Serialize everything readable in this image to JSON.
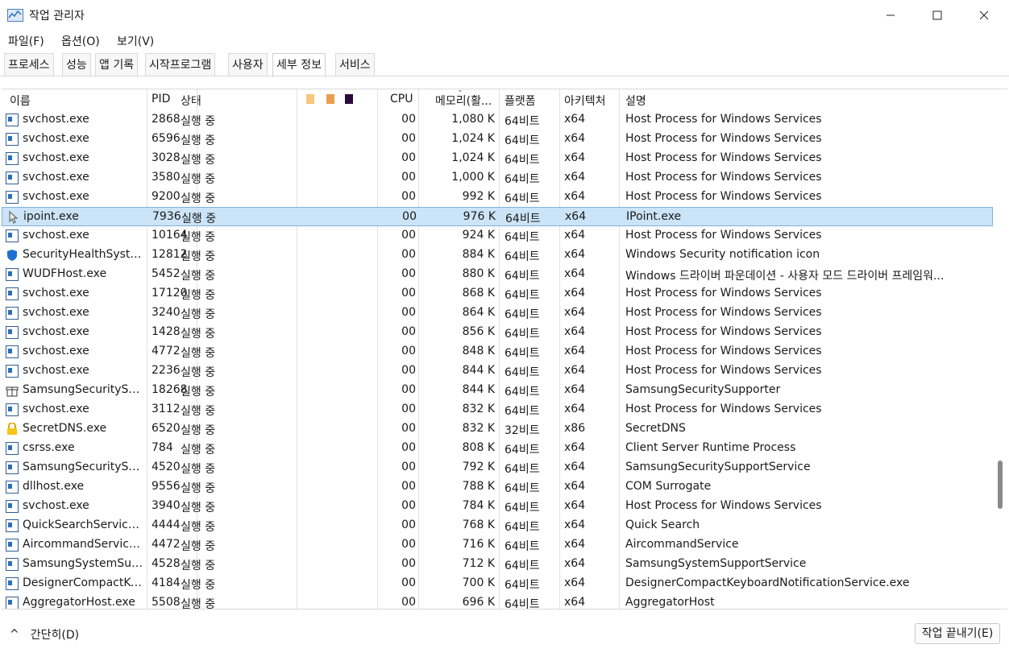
{
  "window": {
    "title": "작업 관리자"
  },
  "menu": [
    {
      "label": "파일(F)"
    },
    {
      "label": "옵션(O)"
    },
    {
      "label": "보기(V)"
    }
  ],
  "tabs": [
    {
      "label": "프로세스"
    },
    {
      "label": "성능"
    },
    {
      "label": "앱 기록"
    },
    {
      "label": "시작프로그램"
    },
    {
      "label": "사용자"
    },
    {
      "label": "세부 정보",
      "active": true
    },
    {
      "label": "서비스"
    }
  ],
  "columns": {
    "name": "이름",
    "pid": "PID",
    "status": "상태",
    "cpu": "CPU",
    "memory": "메모리(활...",
    "platform": "플랫폼",
    "arch": "아키텍처",
    "desc": "설명"
  },
  "rows": [
    {
      "icon": "window-icon",
      "name": "svchost.exe",
      "pid": "2868",
      "status": "실행 중",
      "cpu": "00",
      "mem": "1,080 K",
      "plat": "64비트",
      "arch": "x64",
      "desc": "Host Process for Windows Services"
    },
    {
      "icon": "window-icon",
      "name": "svchost.exe",
      "pid": "6596",
      "status": "실행 중",
      "cpu": "00",
      "mem": "1,024 K",
      "plat": "64비트",
      "arch": "x64",
      "desc": "Host Process for Windows Services"
    },
    {
      "icon": "window-icon",
      "name": "svchost.exe",
      "pid": "3028",
      "status": "실행 중",
      "cpu": "00",
      "mem": "1,024 K",
      "plat": "64비트",
      "arch": "x64",
      "desc": "Host Process for Windows Services"
    },
    {
      "icon": "window-icon",
      "name": "svchost.exe",
      "pid": "3580",
      "status": "실행 중",
      "cpu": "00",
      "mem": "1,000 K",
      "plat": "64비트",
      "arch": "x64",
      "desc": "Host Process for Windows Services"
    },
    {
      "icon": "window-icon",
      "name": "svchost.exe",
      "pid": "9200",
      "status": "실행 중",
      "cpu": "00",
      "mem": "992 K",
      "plat": "64비트",
      "arch": "x64",
      "desc": "Host Process for Windows Services"
    },
    {
      "icon": "cursor-icon",
      "name": "ipoint.exe",
      "pid": "7936",
      "status": "실행 중",
      "cpu": "00",
      "mem": "976 K",
      "plat": "64비트",
      "arch": "x64",
      "desc": "IPoint.exe",
      "selected": true
    },
    {
      "icon": "window-icon",
      "name": "svchost.exe",
      "pid": "10164",
      "status": "실행 중",
      "cpu": "00",
      "mem": "924 K",
      "plat": "64비트",
      "arch": "x64",
      "desc": "Host Process for Windows Services"
    },
    {
      "icon": "shield-icon",
      "name": "SecurityHealthSystra...",
      "pid": "12812",
      "status": "실행 중",
      "cpu": "00",
      "mem": "884 K",
      "plat": "64비트",
      "arch": "x64",
      "desc": "Windows Security notification icon"
    },
    {
      "icon": "window-icon",
      "name": "WUDFHost.exe",
      "pid": "5452",
      "status": "실행 중",
      "cpu": "00",
      "mem": "880 K",
      "plat": "64비트",
      "arch": "x64",
      "desc": "Windows 드라이버 파운데이션 - 사용자 모드 드라이버 프레임워..."
    },
    {
      "icon": "window-icon",
      "name": "svchost.exe",
      "pid": "17120",
      "status": "실행 중",
      "cpu": "00",
      "mem": "868 K",
      "plat": "64비트",
      "arch": "x64",
      "desc": "Host Process for Windows Services"
    },
    {
      "icon": "window-icon",
      "name": "svchost.exe",
      "pid": "3240",
      "status": "실행 중",
      "cpu": "00",
      "mem": "864 K",
      "plat": "64비트",
      "arch": "x64",
      "desc": "Host Process for Windows Services"
    },
    {
      "icon": "window-icon",
      "name": "svchost.exe",
      "pid": "1428",
      "status": "실행 중",
      "cpu": "00",
      "mem": "856 K",
      "plat": "64비트",
      "arch": "x64",
      "desc": "Host Process for Windows Services"
    },
    {
      "icon": "window-icon",
      "name": "svchost.exe",
      "pid": "4772",
      "status": "실행 중",
      "cpu": "00",
      "mem": "848 K",
      "plat": "64비트",
      "arch": "x64",
      "desc": "Host Process for Windows Services"
    },
    {
      "icon": "window-icon",
      "name": "svchost.exe",
      "pid": "2236",
      "status": "실행 중",
      "cpu": "00",
      "mem": "844 K",
      "plat": "64비트",
      "arch": "x64",
      "desc": "Host Process for Windows Services"
    },
    {
      "icon": "gift-icon",
      "name": "SamsungSecuritySup...",
      "pid": "18268",
      "status": "실행 중",
      "cpu": "00",
      "mem": "844 K",
      "plat": "64비트",
      "arch": "x64",
      "desc": "SamsungSecuritySupporter"
    },
    {
      "icon": "window-icon",
      "name": "svchost.exe",
      "pid": "3112",
      "status": "실행 중",
      "cpu": "00",
      "mem": "832 K",
      "plat": "64비트",
      "arch": "x64",
      "desc": "Host Process for Windows Services"
    },
    {
      "icon": "lock-icon",
      "name": "SecretDNS.exe",
      "pid": "6520",
      "status": "실행 중",
      "cpu": "00",
      "mem": "832 K",
      "plat": "32비트",
      "arch": "x86",
      "desc": "SecretDNS"
    },
    {
      "icon": "window-icon",
      "name": "csrss.exe",
      "pid": "784",
      "status": "실행 중",
      "cpu": "00",
      "mem": "808 K",
      "plat": "64비트",
      "arch": "x64",
      "desc": "Client Server Runtime Process"
    },
    {
      "icon": "window-icon",
      "name": "SamsungSecuritySup...",
      "pid": "4520",
      "status": "실행 중",
      "cpu": "00",
      "mem": "792 K",
      "plat": "64비트",
      "arch": "x64",
      "desc": "SamsungSecuritySupportService"
    },
    {
      "icon": "window-icon",
      "name": "dllhost.exe",
      "pid": "9556",
      "status": "실행 중",
      "cpu": "00",
      "mem": "788 K",
      "plat": "64비트",
      "arch": "x64",
      "desc": "COM Surrogate"
    },
    {
      "icon": "window-icon",
      "name": "svchost.exe",
      "pid": "3940",
      "status": "실행 중",
      "cpu": "00",
      "mem": "784 K",
      "plat": "64비트",
      "arch": "x64",
      "desc": "Host Process for Windows Services"
    },
    {
      "icon": "window-icon",
      "name": "QuickSearchService....",
      "pid": "4444",
      "status": "실행 중",
      "cpu": "00",
      "mem": "768 K",
      "plat": "64비트",
      "arch": "x64",
      "desc": "Quick Search"
    },
    {
      "icon": "window-icon",
      "name": "AircommandService....",
      "pid": "4472",
      "status": "실행 중",
      "cpu": "00",
      "mem": "716 K",
      "plat": "64비트",
      "arch": "x64",
      "desc": "AircommandService"
    },
    {
      "icon": "window-icon",
      "name": "SamsungSystemSup...",
      "pid": "4528",
      "status": "실행 중",
      "cpu": "00",
      "mem": "712 K",
      "plat": "64비트",
      "arch": "x64",
      "desc": "SamsungSystemSupportService"
    },
    {
      "icon": "window-icon",
      "name": "DesignerCompactKe...",
      "pid": "4184",
      "status": "실행 중",
      "cpu": "00",
      "mem": "700 K",
      "plat": "64비트",
      "arch": "x64",
      "desc": "DesignerCompactKeyboardNotificationService.exe"
    },
    {
      "icon": "window-icon",
      "name": "AggregatorHost.exe",
      "pid": "5508",
      "status": "실행 중",
      "cpu": "00",
      "mem": "696 K",
      "plat": "64비트",
      "arch": "x64",
      "desc": "AggregatorHost"
    }
  ],
  "footer": {
    "fewer_details": "간단히(D)",
    "end_task": "작업 끝내기(E)"
  },
  "colors": {
    "accent": "#2c6fb8",
    "selection": "#cce4f7"
  }
}
